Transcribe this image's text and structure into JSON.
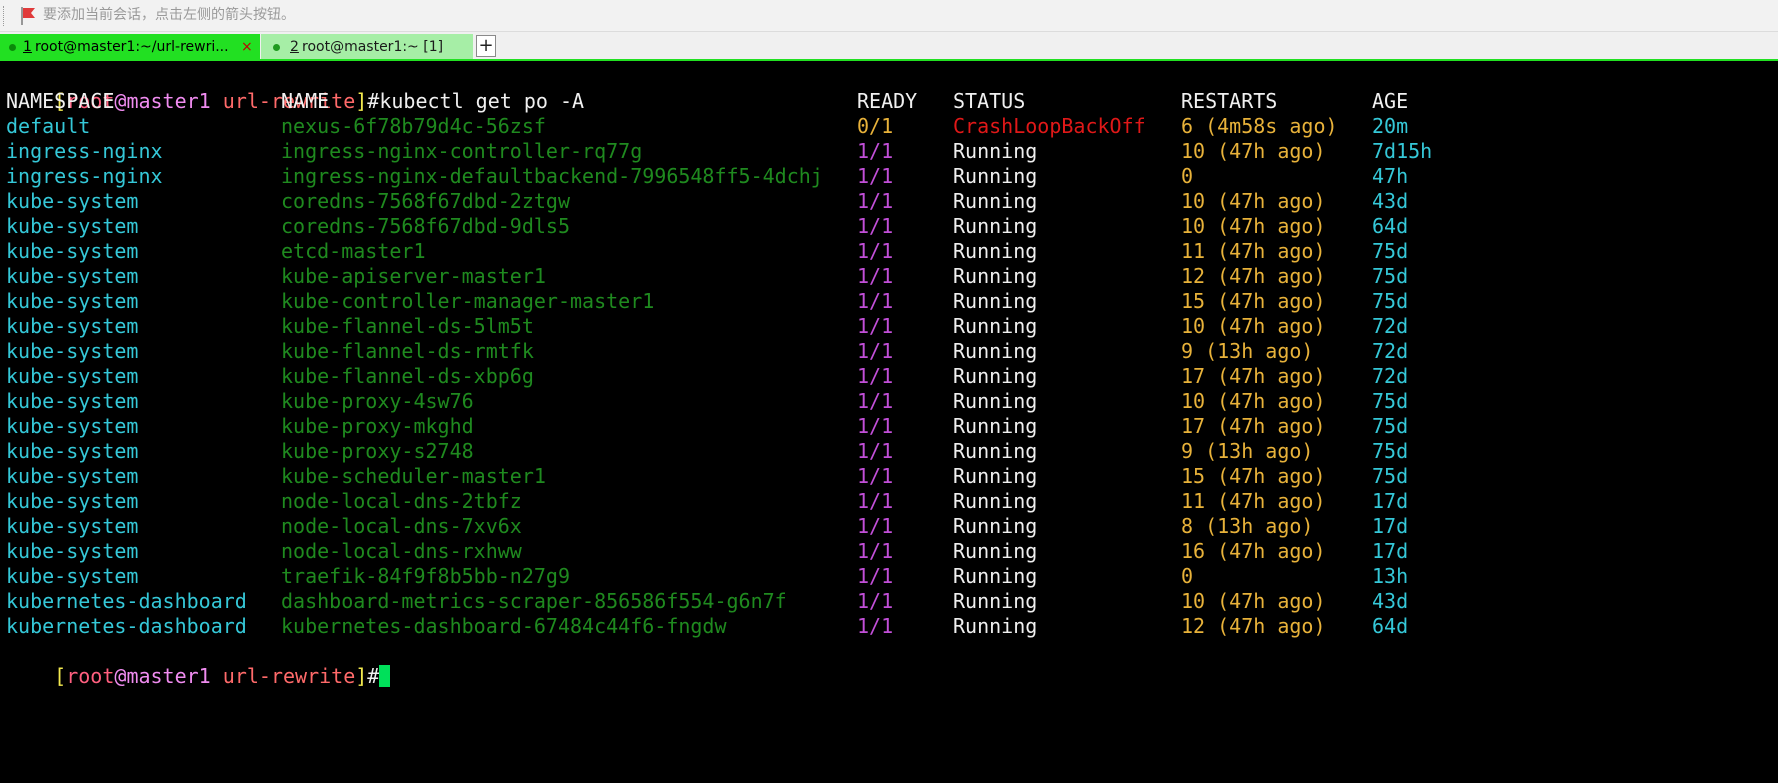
{
  "session_bar": {
    "hint": "要添加当前会话，点击左侧的箭头按钮。",
    "icon": "bookmark-flag-icon"
  },
  "tabs": [
    {
      "number": "1",
      "label": " root@master1:~/url-rewri...",
      "active": true
    },
    {
      "number": "2",
      "label": " root@master1:~ [1]",
      "active": false
    }
  ],
  "tab_close_label": "×",
  "tab_add_label": "+",
  "colors": {
    "tab_active": "#22e022",
    "tab_inactive": "#a6eea6",
    "terminal_bg": "#000000",
    "namespace": "#35c8d8",
    "pod_name": "#1f8a1f",
    "ready": "#c24fd8",
    "status_error": "#e01818",
    "restarts": "#e8b23a",
    "cursor": "#00e05a"
  },
  "terminal": {
    "prompt": {
      "open": "[",
      "user": "root",
      "at": "@",
      "host": "master1",
      "space": " ",
      "dir": "url-rewrite",
      "close": "]",
      "hash": "#"
    },
    "command": "kubectl get po -A",
    "headers": {
      "namespace": "NAMESPACE",
      "name": "NAME",
      "ready": "READY",
      "status": "STATUS",
      "restarts": "RESTARTS",
      "age": "AGE"
    },
    "rows": [
      {
        "namespace": "default",
        "name": "nexus-6f78b79d4c-56zsf",
        "ready": "0/1",
        "status": "CrashLoopBackOff",
        "restarts": "6 (4m58s ago)",
        "age": "20m"
      },
      {
        "namespace": "ingress-nginx",
        "name": "ingress-nginx-controller-rq77g",
        "ready": "1/1",
        "status": "Running",
        "restarts": "10 (47h ago)",
        "age": "7d15h"
      },
      {
        "namespace": "ingress-nginx",
        "name": "ingress-nginx-defaultbackend-7996548ff5-4dchj",
        "ready": "1/1",
        "status": "Running",
        "restarts": "0",
        "age": "47h"
      },
      {
        "namespace": "kube-system",
        "name": "coredns-7568f67dbd-2ztgw",
        "ready": "1/1",
        "status": "Running",
        "restarts": "10 (47h ago)",
        "age": "43d"
      },
      {
        "namespace": "kube-system",
        "name": "coredns-7568f67dbd-9dls5",
        "ready": "1/1",
        "status": "Running",
        "restarts": "10 (47h ago)",
        "age": "64d"
      },
      {
        "namespace": "kube-system",
        "name": "etcd-master1",
        "ready": "1/1",
        "status": "Running",
        "restarts": "11 (47h ago)",
        "age": "75d"
      },
      {
        "namespace": "kube-system",
        "name": "kube-apiserver-master1",
        "ready": "1/1",
        "status": "Running",
        "restarts": "12 (47h ago)",
        "age": "75d"
      },
      {
        "namespace": "kube-system",
        "name": "kube-controller-manager-master1",
        "ready": "1/1",
        "status": "Running",
        "restarts": "15 (47h ago)",
        "age": "75d"
      },
      {
        "namespace": "kube-system",
        "name": "kube-flannel-ds-5lm5t",
        "ready": "1/1",
        "status": "Running",
        "restarts": "10 (47h ago)",
        "age": "72d"
      },
      {
        "namespace": "kube-system",
        "name": "kube-flannel-ds-rmtfk",
        "ready": "1/1",
        "status": "Running",
        "restarts": "9 (13h ago)",
        "age": "72d"
      },
      {
        "namespace": "kube-system",
        "name": "kube-flannel-ds-xbp6g",
        "ready": "1/1",
        "status": "Running",
        "restarts": "17 (47h ago)",
        "age": "72d"
      },
      {
        "namespace": "kube-system",
        "name": "kube-proxy-4sw76",
        "ready": "1/1",
        "status": "Running",
        "restarts": "10 (47h ago)",
        "age": "75d"
      },
      {
        "namespace": "kube-system",
        "name": "kube-proxy-mkghd",
        "ready": "1/1",
        "status": "Running",
        "restarts": "17 (47h ago)",
        "age": "75d"
      },
      {
        "namespace": "kube-system",
        "name": "kube-proxy-s2748",
        "ready": "1/1",
        "status": "Running",
        "restarts": "9 (13h ago)",
        "age": "75d"
      },
      {
        "namespace": "kube-system",
        "name": "kube-scheduler-master1",
        "ready": "1/1",
        "status": "Running",
        "restarts": "15 (47h ago)",
        "age": "75d"
      },
      {
        "namespace": "kube-system",
        "name": "node-local-dns-2tbfz",
        "ready": "1/1",
        "status": "Running",
        "restarts": "11 (47h ago)",
        "age": "17d"
      },
      {
        "namespace": "kube-system",
        "name": "node-local-dns-7xv6x",
        "ready": "1/1",
        "status": "Running",
        "restarts": "8 (13h ago)",
        "age": "17d"
      },
      {
        "namespace": "kube-system",
        "name": "node-local-dns-rxhww",
        "ready": "1/1",
        "status": "Running",
        "restarts": "16 (47h ago)",
        "age": "17d"
      },
      {
        "namespace": "kube-system",
        "name": "traefik-84f9f8b5bb-n27g9",
        "ready": "1/1",
        "status": "Running",
        "restarts": "0",
        "age": "13h"
      },
      {
        "namespace": "kubernetes-dashboard",
        "name": "dashboard-metrics-scraper-856586f554-g6n7f",
        "ready": "1/1",
        "status": "Running",
        "restarts": "10 (47h ago)",
        "age": "43d"
      },
      {
        "namespace": "kubernetes-dashboard",
        "name": "kubernetes-dashboard-67484c44f6-fngdw",
        "ready": "1/1",
        "status": "Running",
        "restarts": "12 (47h ago)",
        "age": "64d"
      }
    ]
  }
}
